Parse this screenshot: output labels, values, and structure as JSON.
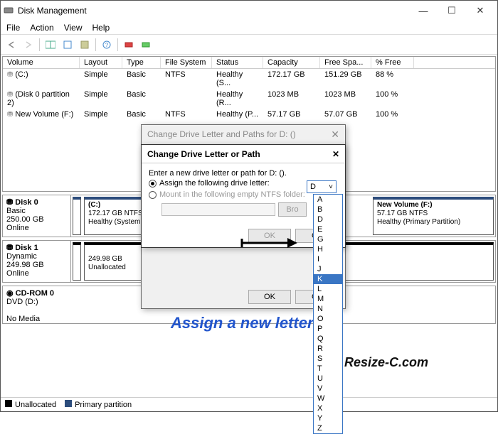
{
  "window_title": "Disk Management",
  "menu": [
    "File",
    "Action",
    "View",
    "Help"
  ],
  "columns": [
    "Volume",
    "Layout",
    "Type",
    "File System",
    "Status",
    "Capacity",
    "Free Spa...",
    "% Free"
  ],
  "volumes": [
    {
      "name": "(C:)",
      "layout": "Simple",
      "type": "Basic",
      "fs": "NTFS",
      "status": "Healthy (S...",
      "cap": "172.17 GB",
      "free": "151.29 GB",
      "pct": "88 %"
    },
    {
      "name": "(Disk 0 partition 2)",
      "layout": "Simple",
      "type": "Basic",
      "fs": "",
      "status": "Healthy (R...",
      "cap": "1023 MB",
      "free": "1023 MB",
      "pct": "100 %"
    },
    {
      "name": "New Volume (F:)",
      "layout": "Simple",
      "type": "Basic",
      "fs": "NTFS",
      "status": "Healthy (P...",
      "cap": "57.17 GB",
      "free": "57.07 GB",
      "pct": "100 %"
    }
  ],
  "disks": {
    "d0": {
      "name": "Disk 0",
      "type": "Basic",
      "size": "250.00 GB",
      "status": "Online",
      "parts": [
        {
          "title": "(C:)",
          "line2": "172.17 GB NTFS",
          "line3": "Healthy (System, Boo"
        },
        {
          "title": "",
          "line2": "",
          "line3": ""
        },
        {
          "title": "New Volume  (F:)",
          "line2": "57.17 GB NTFS",
          "line3": "Healthy (Primary Partition)"
        }
      ]
    },
    "d1": {
      "name": "Disk 1",
      "type": "Dynamic",
      "size": "249.98 GB",
      "status": "Online",
      "parts": [
        {
          "title": "",
          "line2": "249.98 GB",
          "line3": "Unallocated"
        }
      ]
    },
    "cd": {
      "name": "CD-ROM 0",
      "type2": "DVD (D:)",
      "status": "No Media"
    }
  },
  "legend": {
    "unalloc": "Unallocated",
    "primary": "Primary partition"
  },
  "dialog1": {
    "title": "Change Drive Letter and Paths for D: ()",
    "ok": "OK",
    "cancel": "Ca"
  },
  "dialog2": {
    "title": "Change Drive Letter or Path",
    "prompt": "Enter a new drive letter or path for D: ().",
    "opt1": "Assign the following drive letter:",
    "opt2": "Mount in the following empty NTFS folder:",
    "browse": "Bro",
    "ok": "OK",
    "cancel": "Ca",
    "selected": "D",
    "letters": [
      "A",
      "B",
      "D",
      "E",
      "G",
      "H",
      "I",
      "J",
      "K",
      "L",
      "M",
      "N",
      "O",
      "P",
      "Q",
      "R",
      "S",
      "T",
      "U",
      "V",
      "W",
      "X",
      "Y",
      "Z"
    ],
    "highlight": "K"
  },
  "annotation": "Assign a new letter",
  "watermark": "Resize-C.com"
}
